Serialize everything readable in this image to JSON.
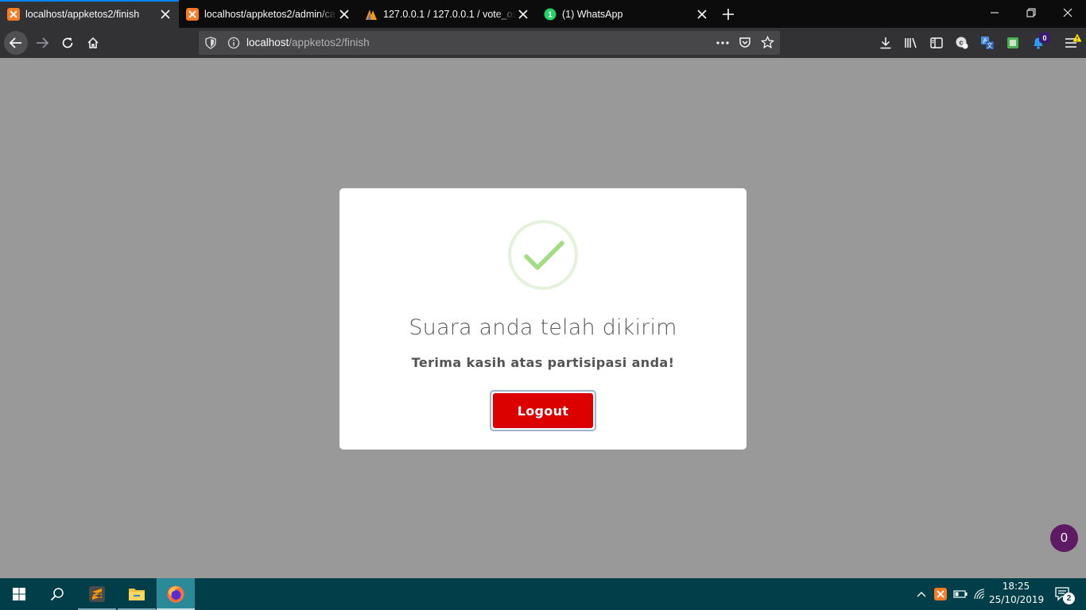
{
  "browser": {
    "tabs": [
      {
        "title": "localhost/appketos2/finish",
        "icon": "xampp-icon"
      },
      {
        "title": "localhost/appketos2/admin/ca",
        "icon": "xampp-icon"
      },
      {
        "title": "127.0.0.1 / 127.0.0.1 / vote_osis",
        "icon": "phpmyadmin-icon"
      },
      {
        "title": "(1) WhatsApp",
        "icon": "whatsapp-icon"
      }
    ],
    "url_host": "localhost",
    "url_path": "/appketos2/finish",
    "extension_badge": "0"
  },
  "modal": {
    "title": "Suara anda telah dikirim",
    "message": "Terima kasih atas partisipasi anda!",
    "button_label": "Logout",
    "icon": "success-check-icon"
  },
  "counter_badge": "0",
  "taskbar": {
    "time": "18:25",
    "date": "25/10/2019",
    "notification_count": "2"
  },
  "colors": {
    "tab_accent": "#0a84ff",
    "logout_button": "#dd0000",
    "check": "#a5dc86",
    "taskbar": "#003f4a",
    "counter_badge": "#5e1a63"
  }
}
